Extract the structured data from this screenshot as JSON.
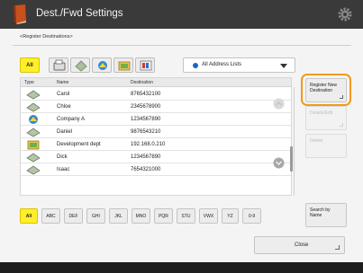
{
  "title": "Dest./Fwd Settings",
  "subtitle": "<Register Destinations>",
  "filter": {
    "all_label": "All",
    "address_list": "All Address Lists"
  },
  "table": {
    "headers": {
      "type": "Type",
      "name": "Name",
      "destination": "Destination"
    },
    "rows": [
      {
        "type": "email",
        "name": "Carol",
        "destination": "8765432100"
      },
      {
        "type": "email",
        "name": "Chloe",
        "destination": "2345678900"
      },
      {
        "type": "group",
        "name": "Company A",
        "destination": "1234567890"
      },
      {
        "type": "email",
        "name": "Daniel",
        "destination": "9876543210"
      },
      {
        "type": "file",
        "name": "Development dept",
        "destination": "192.168.0.210"
      },
      {
        "type": "email",
        "name": "Dick",
        "destination": "1234567890"
      },
      {
        "type": "email",
        "name": "Isaac",
        "destination": "7654321000"
      }
    ]
  },
  "side_buttons": {
    "register": "Register New Destination",
    "details_edit": "Details/Edit",
    "delete": "Delete",
    "search": "Search by Name"
  },
  "alphabet": [
    "All",
    "ABC",
    "DEF",
    "GHI",
    "JKL",
    "MNO",
    "PQR",
    "STU",
    "VWX",
    "YZ",
    "0-9"
  ],
  "close_label": "Close",
  "colors": {
    "accent_yellow": "#ffef2b",
    "highlight_orange": "#f39a14",
    "titlebar": "#3a3a3a"
  }
}
